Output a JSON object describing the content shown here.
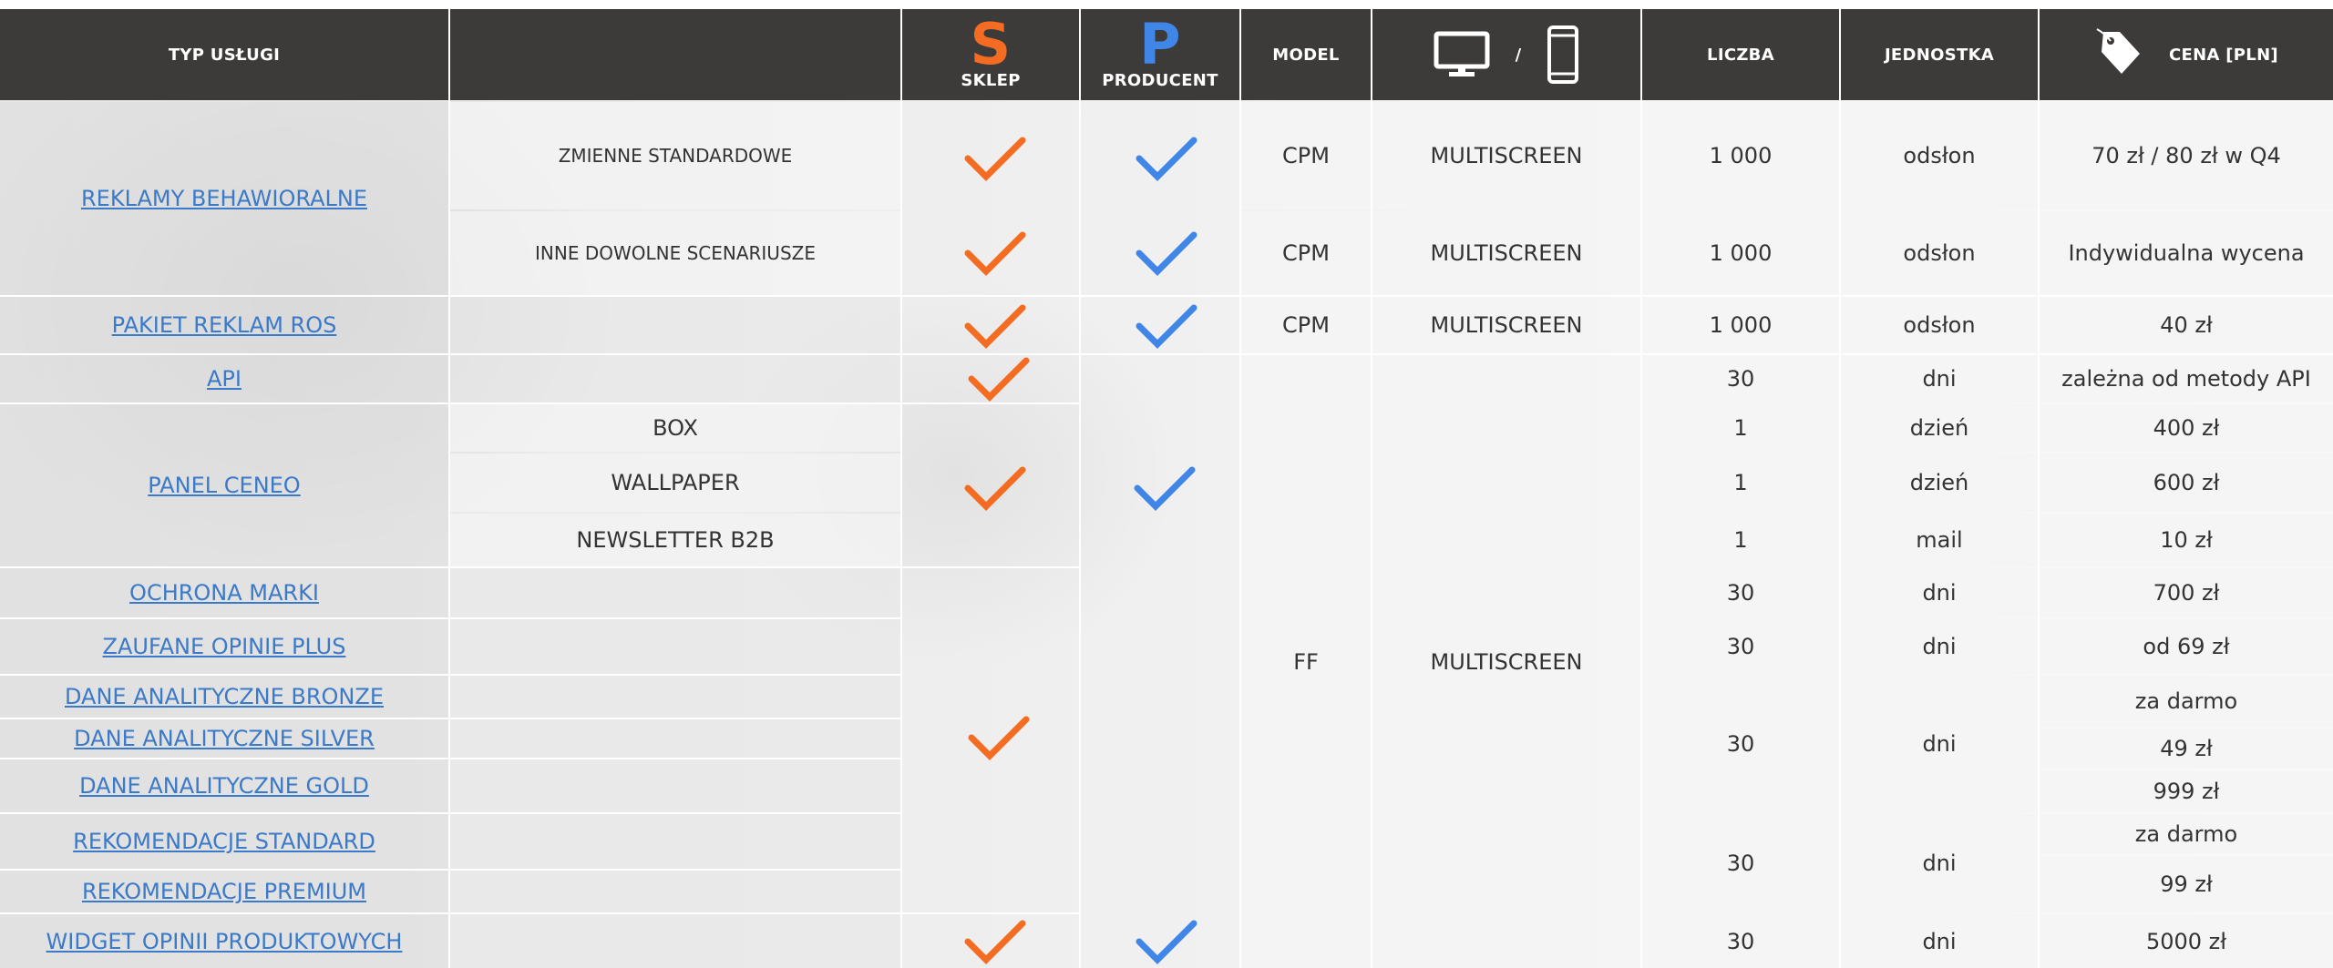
{
  "header": {
    "typ_uslugi": "TYP USŁUGI",
    "sklep_letter": "S",
    "sklep": "SKLEP",
    "producent_letter": "P",
    "producent": "PRODUCENT",
    "model": "MODEL",
    "device_sep": "/",
    "liczba": "LICZBA",
    "jednostka": "JEDNOSTKA",
    "cena": "CENA [PLN]"
  },
  "colors": {
    "header_bg": "#3d3b39",
    "sklep_orange": "#f36c21",
    "producent_blue": "#3f86e6",
    "link_blue": "#3b79c9"
  },
  "icons": [
    "monitor-icon",
    "smartphone-icon",
    "price-tag-icon",
    "check-icon"
  ],
  "services": [
    {
      "name": "REKLAMY BEHAWIORALNE",
      "variants": [
        "ZMIENNE STANDARDOWE",
        "INNE DOWOLNE SCENARIUSZE"
      ]
    },
    {
      "name": "PAKIET REKLAM ROS"
    },
    {
      "name": "API"
    },
    {
      "name": "PANEL CENEO",
      "variants": [
        "BOX",
        "WALLPAPER",
        "NEWSLETTER B2B"
      ]
    },
    {
      "name": "OCHRONA MARKI"
    },
    {
      "name": "ZAUFANE OPINIE PLUS"
    },
    {
      "name": "DANE ANALITYCZNE BRONZE"
    },
    {
      "name": "DANE ANALITYCZNE SILVER"
    },
    {
      "name": "DANE ANALITYCZNE GOLD"
    },
    {
      "name": "REKOMENDACJE STANDARD"
    },
    {
      "name": "REKOMENDACJE PREMIUM"
    },
    {
      "name": "WIDGET OPINII PRODUKTOWYCH"
    }
  ],
  "model": {
    "cpm": "CPM",
    "ff": "FF"
  },
  "device": {
    "multiscreen": "MULTISCREEN"
  },
  "liczba": {
    "l1000": "1 000",
    "l30": "30",
    "l1": "1"
  },
  "jednostka": {
    "odslon": "odsłon",
    "dni": "dni",
    "dzien": "dzień",
    "mail": "mail"
  },
  "cena": {
    "p1": "70 zł / 80 zł w Q4",
    "p2": "Indywidualna wycena",
    "p3": "40 zł",
    "p4": "zależna od metody API",
    "p5": "400 zł",
    "p6": "600 zł",
    "p7": "10 zł",
    "p8": "700 zł",
    "p9": "od 69 zł",
    "p10": "za darmo",
    "p11": "49 zł",
    "p12": "999 zł",
    "p13": "za darmo",
    "p14": "99 zł",
    "p15": "5000 zł"
  }
}
